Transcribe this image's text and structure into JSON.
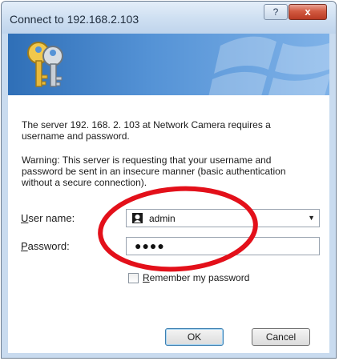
{
  "window": {
    "title": "Connect to 192.168.2.103",
    "help_label": "?",
    "close_label": "x"
  },
  "message": {
    "intro_line1": "The server 192. 168. 2. 103 at Network Camera requires a",
    "intro_line2": "username and password.",
    "warning_line1": "Warning: This server is requesting that your username and",
    "warning_line2": "password be sent in an insecure manner (basic authentication",
    "warning_line3": "without a secure connection)."
  },
  "form": {
    "username_label_first": "U",
    "username_label_rest": "ser name:",
    "username_value": "admin",
    "password_label_first": "P",
    "password_label_rest": "assword:",
    "password_value": "●●●●",
    "remember_label_first": "R",
    "remember_label_rest": "emember my password",
    "remember_checked": false
  },
  "buttons": {
    "ok_label": "OK",
    "cancel_label": "Cancel"
  },
  "icons": {
    "banner": "keys-icon",
    "user": "user-icon",
    "dropdown": "chevron-down-icon"
  },
  "colors": {
    "annotation": "#e3101a",
    "banner_start": "#2f6fb7",
    "close_button": "#c8452e"
  }
}
